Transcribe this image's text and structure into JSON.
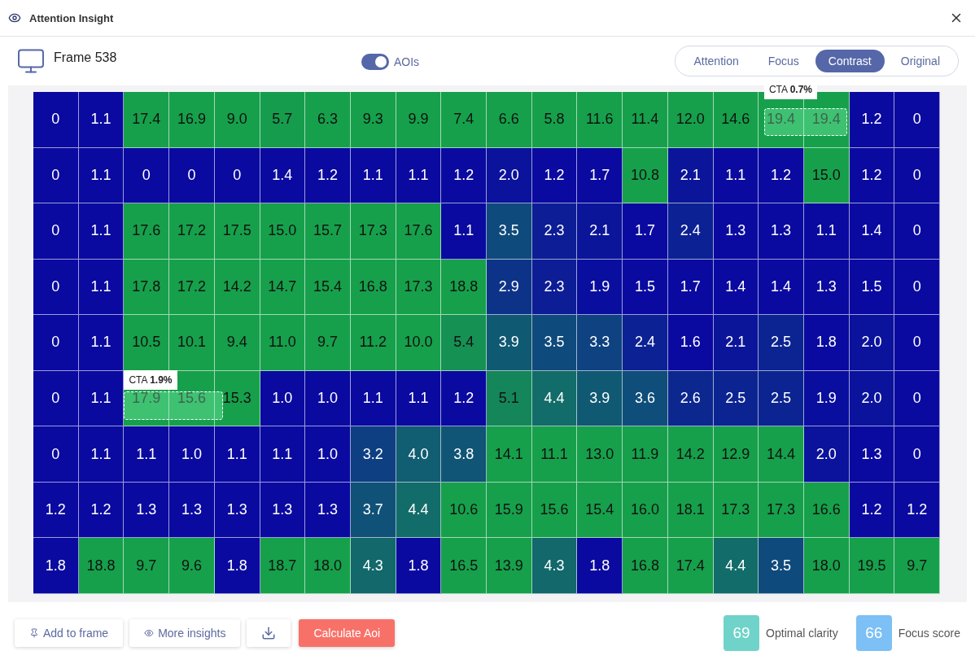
{
  "window": {
    "title": "Attention Insight"
  },
  "frame": {
    "name": "Frame 538"
  },
  "aoi_toggle": {
    "label": "AOIs",
    "on": true
  },
  "view_tabs": [
    {
      "label": "Attention",
      "selected": false
    },
    {
      "label": "Focus",
      "selected": false
    },
    {
      "label": "Contrast",
      "selected": true
    },
    {
      "label": "Original",
      "selected": false
    }
  ],
  "heatmap": {
    "rows": [
      [
        "0",
        "1.1",
        "17.4",
        "16.9",
        "9.0",
        "5.7",
        "6.3",
        "9.3",
        "9.9",
        "7.4",
        "6.6",
        "5.8",
        "11.6",
        "11.4",
        "12.0",
        "14.6",
        "19.4",
        "19.4",
        "1.2",
        "0"
      ],
      [
        "0",
        "1.1",
        "0",
        "0",
        "0",
        "1.4",
        "1.2",
        "1.1",
        "1.1",
        "1.2",
        "2.0",
        "1.2",
        "1.7",
        "10.8",
        "2.1",
        "1.1",
        "1.2",
        "15.0",
        "1.2",
        "0"
      ],
      [
        "0",
        "1.1",
        "17.6",
        "17.2",
        "17.5",
        "15.0",
        "15.7",
        "17.3",
        "17.6",
        "1.1",
        "3.5",
        "2.3",
        "2.1",
        "1.7",
        "2.4",
        "1.3",
        "1.3",
        "1.1",
        "1.4",
        "0"
      ],
      [
        "0",
        "1.1",
        "17.8",
        "17.2",
        "14.2",
        "14.7",
        "15.4",
        "16.8",
        "17.3",
        "18.8",
        "2.9",
        "2.3",
        "1.9",
        "1.5",
        "1.7",
        "1.4",
        "1.4",
        "1.3",
        "1.5",
        "0"
      ],
      [
        "0",
        "1.1",
        "10.5",
        "10.1",
        "9.4",
        "11.0",
        "9.7",
        "11.2",
        "10.0",
        "5.4",
        "3.9",
        "3.5",
        "3.3",
        "2.4",
        "1.6",
        "2.1",
        "2.5",
        "1.8",
        "2.0",
        "0"
      ],
      [
        "0",
        "1.1",
        "17.9",
        "15.6",
        "15.3",
        "1.0",
        "1.0",
        "1.1",
        "1.1",
        "1.2",
        "5.1",
        "4.4",
        "3.9",
        "3.6",
        "2.6",
        "2.5",
        "2.5",
        "1.9",
        "2.0",
        "0"
      ],
      [
        "0",
        "1.1",
        "1.1",
        "1.0",
        "1.1",
        "1.1",
        "1.0",
        "3.2",
        "4.0",
        "3.8",
        "14.1",
        "11.1",
        "13.0",
        "11.9",
        "14.2",
        "12.9",
        "14.4",
        "2.0",
        "1.3",
        "0"
      ],
      [
        "1.2",
        "1.2",
        "1.3",
        "1.3",
        "1.3",
        "1.3",
        "1.3",
        "3.7",
        "4.4",
        "10.6",
        "15.9",
        "15.6",
        "15.4",
        "16.0",
        "18.1",
        "17.3",
        "17.3",
        "16.6",
        "1.2",
        "1.2"
      ],
      [
        "1.8",
        "18.8",
        "9.7",
        "9.6",
        "1.8",
        "18.7",
        "18.0",
        "4.3",
        "1.8",
        "16.5",
        "13.9",
        "4.3",
        "1.8",
        "16.8",
        "17.4",
        "4.4",
        "3.5",
        "18.0",
        "19.5",
        "9.7"
      ]
    ],
    "aois": [
      {
        "label": "CTA",
        "value": "0.7%"
      },
      {
        "label": "CTA",
        "value": "1.9%"
      }
    ]
  },
  "actions": [
    "Add to frame",
    "More insights"
  ],
  "calculate_button": "Calculate Aoi",
  "scores": [
    {
      "value": "69",
      "label": "Optimal clarity",
      "color": "#6fd3c9"
    },
    {
      "value": "66",
      "label": "Focus score",
      "color": "#7cc0f5"
    }
  ]
}
